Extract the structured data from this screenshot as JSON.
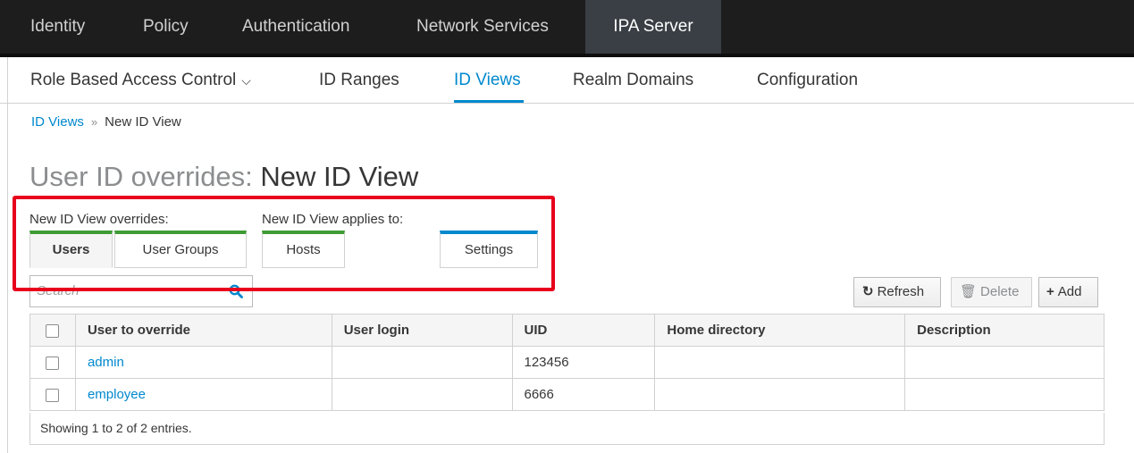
{
  "top_nav": {
    "items": [
      {
        "label": "Identity"
      },
      {
        "label": "Policy"
      },
      {
        "label": "Authentication"
      },
      {
        "label": "Network Services"
      },
      {
        "label": "IPA Server",
        "active": true
      }
    ]
  },
  "sub_nav": {
    "items": [
      {
        "label": "Role Based Access Control"
      },
      {
        "label": "ID Ranges"
      },
      {
        "label": "ID Views",
        "active": true
      },
      {
        "label": "Realm Domains"
      },
      {
        "label": "Configuration"
      }
    ]
  },
  "breadcrumb": {
    "link": "ID Views",
    "separator": "»",
    "current": "New ID View"
  },
  "page_title": {
    "prefix": "User ID overrides:",
    "name": "New ID View"
  },
  "tab_groups": {
    "overrides_label": "New ID View overrides:",
    "applies_label": "New ID View applies to:"
  },
  "tabs": {
    "users": "Users",
    "user_groups": "User Groups",
    "hosts": "Hosts",
    "settings": "Settings"
  },
  "search": {
    "placeholder": "Search",
    "icon": "search-icon"
  },
  "toolbar": {
    "refresh": "Refresh",
    "delete": "Delete",
    "add": "Add"
  },
  "table": {
    "headers": [
      "User to override",
      "User login",
      "UID",
      "Home directory",
      "Description"
    ],
    "rows": [
      {
        "user": "admin",
        "login": "",
        "uid": "123456",
        "home": "",
        "description": ""
      },
      {
        "user": "employee",
        "login": "",
        "uid": "6666",
        "home": "",
        "description": ""
      }
    ],
    "footer": "Showing 1 to 2 of 2 entries."
  },
  "colors": {
    "accent": "#0088ce",
    "tab_green": "#3f9c35",
    "highlight_red": "#e8001c",
    "topbar": "#1d1d1d"
  }
}
